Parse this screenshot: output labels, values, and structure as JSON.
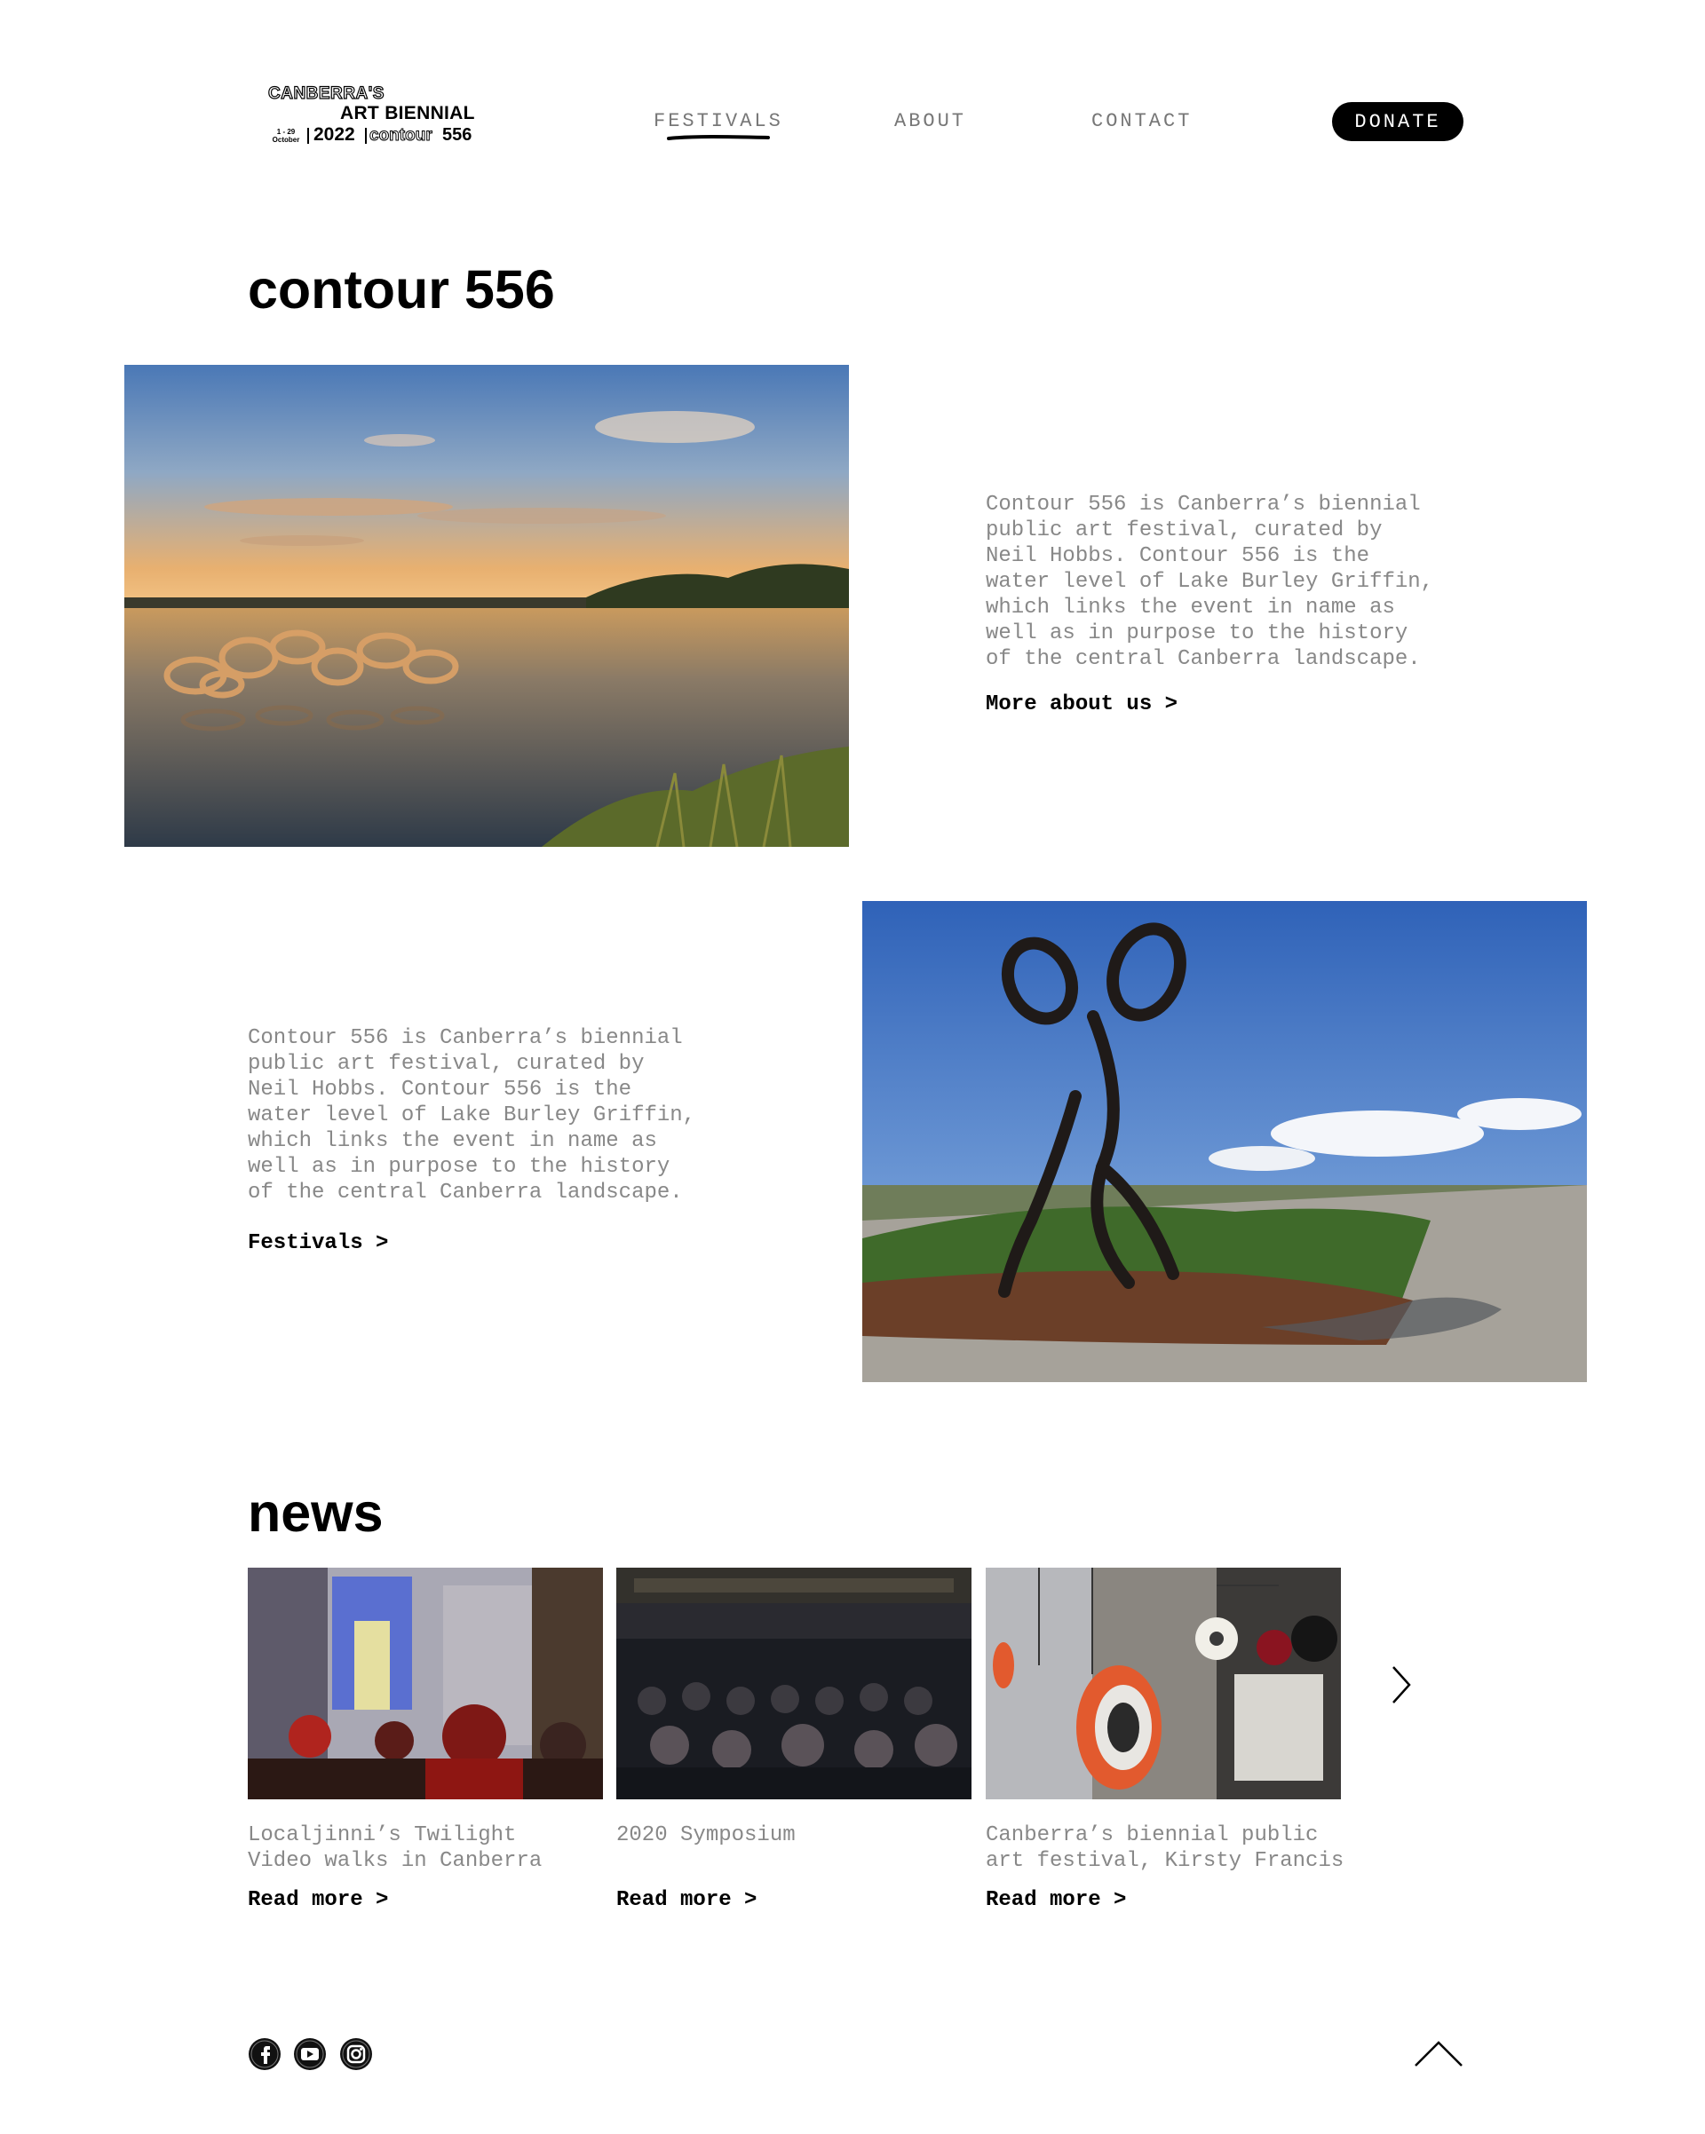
{
  "logo": {
    "line1": "CANBERRA'S",
    "line2": "ART BIENNIAL",
    "dates_line1": "1 - 29",
    "dates_line2": "October",
    "year": "2022",
    "contour": "contour",
    "number": "556"
  },
  "nav": {
    "items": [
      {
        "label": "FESTIVALS",
        "active": true
      },
      {
        "label": "ABOUT",
        "active": false
      },
      {
        "label": "CONTACT",
        "active": false
      }
    ],
    "donate_label": "DONATE"
  },
  "intro": {
    "title": "contour 556",
    "paragraph1": "Contour 556 is Canberra’s biennial\npublic art festival, curated by\nNeil Hobbs. Contour 556 is the\nwater level of Lake Burley Griffin,\nwhich links the event in name as\nwell as in purpose to the history\nof the central Canberra landscape.",
    "link1": "More about us >",
    "paragraph2": "Contour 556 is Canberra’s biennial\npublic art festival, curated by\nNeil Hobbs. Contour 556 is the\nwater level of Lake Burley Griffin,\nwhich links the event in name as\nwell as in purpose to the history\nof the central Canberra landscape.",
    "link2": "Festivals >"
  },
  "news": {
    "title": "news",
    "items": [
      {
        "caption": "Localjinni’s Twilight\nVideo walks in Canberra",
        "read_more": "Read more >"
      },
      {
        "caption": "2020 Symposium",
        "read_more": "Read more >"
      },
      {
        "caption": "Canberra’s biennial public\nart festival, Kirsty Francis",
        "read_more": "Read more >"
      }
    ]
  },
  "footer": {
    "social_icons": [
      "facebook-icon",
      "youtube-icon",
      "instagram-icon"
    ],
    "scroll_top_icon": "chevron-up-icon"
  },
  "colors": {
    "text": "#000000",
    "body_text": "#888888",
    "nav_text": "#777777",
    "donate_bg": "#000000",
    "background": "#ffffff"
  }
}
